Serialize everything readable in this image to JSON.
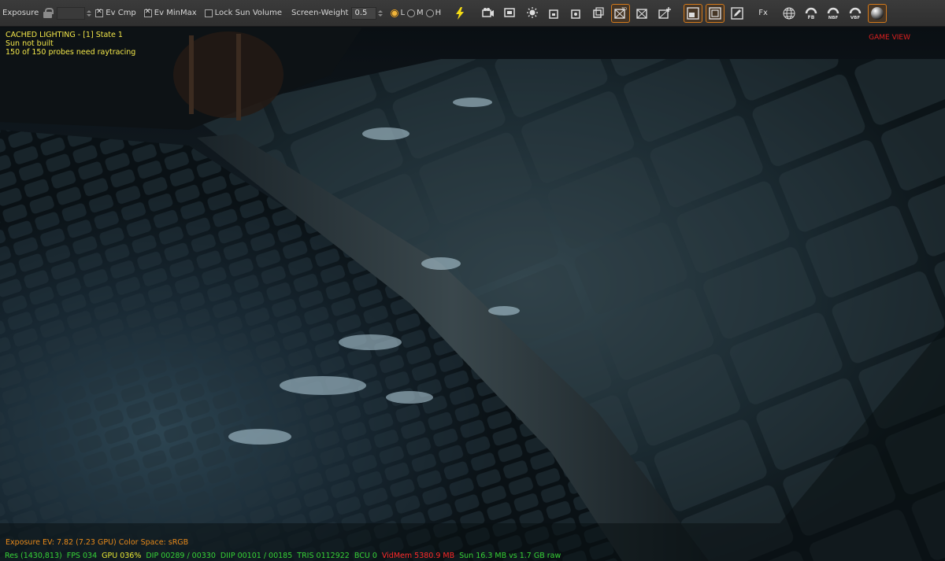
{
  "toolbar": {
    "exposure_label": "Exposure",
    "exposure_value": "",
    "ev_cmp_label": "Ev Cmp",
    "ev_cmp_checked": true,
    "ev_minmax_label": "Ev MinMax",
    "ev_minmax_checked": true,
    "lock_sun_label": "Lock Sun Volume",
    "lock_sun_checked": false,
    "screen_weight_label": "Screen-Weight",
    "screen_weight_value": "0.5",
    "quality_options": [
      "L",
      "M",
      "H"
    ],
    "quality_selected": "L",
    "fx_label": "Fx",
    "icons": [
      "lightning-icon",
      "camera-3d-icon",
      "view-3d-icon",
      "sun-icon",
      "box-3d-icon",
      "box-3d-alt-icon",
      "box-snapshot-icon",
      "grid-3d-icon",
      "grid-icon",
      "grid-add-icon",
      "render-target-icon",
      "frame-icon",
      "edit-icon",
      "fx-icon",
      "mesh-sphere-icon",
      "fb-icon",
      "nbf-icon",
      "vbf-icon",
      "material-sphere-icon"
    ],
    "icon_labels": {
      "fb": "FB",
      "nbf": "NBF",
      "vbf": "VBF",
      "t3d": "3D"
    },
    "accent": "#d37a1c"
  },
  "viewport": {
    "top_info": [
      "CACHED LIGHTING - [1] State 1",
      "Sun not built",
      "150 of 150 probes need raytracing"
    ],
    "game_view_label": "GAME VIEW",
    "bottom_info": "Exposure EV: 7.82 (7.23 GPU)  Color Space: sRGB",
    "stats": [
      {
        "text": "Res (1430,813)",
        "color": "green"
      },
      {
        "text": "FPS 034",
        "color": "green"
      },
      {
        "text": "GPU 036%",
        "color": "yellow"
      },
      {
        "text": "DIP 00289 / 00330",
        "color": "green"
      },
      {
        "text": "DIIP 00101 / 00185",
        "color": "green"
      },
      {
        "text": "TRIS 0112922",
        "color": "green"
      },
      {
        "text": "BCU 0",
        "color": "green"
      },
      {
        "text": "VidMem 5380.9 MB",
        "color": "red"
      },
      {
        "text": "Sun 16.3 MB vs 1.7 GB raw",
        "color": "green"
      }
    ],
    "colors": {
      "top_info": "#f4e84a",
      "game_view": "#e02020",
      "bottom_info": "#e88a1a",
      "green": "#36d236",
      "yellow": "#e6e633",
      "red": "#ff2a2a"
    }
  }
}
